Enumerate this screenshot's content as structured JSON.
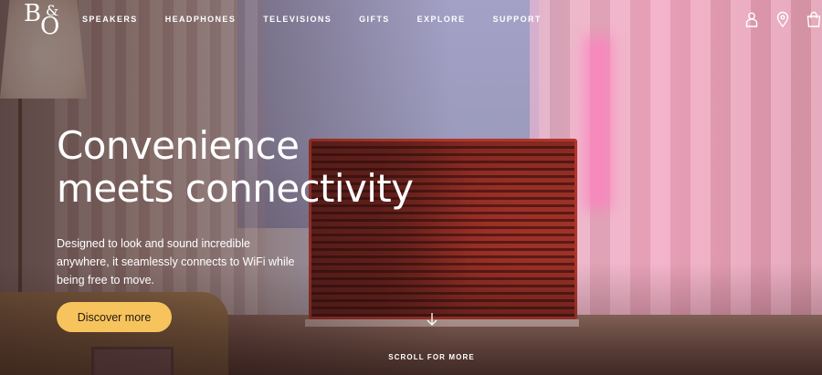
{
  "brand": {
    "logo_top": "B",
    "logo_amp": "&",
    "logo_bottom": "O"
  },
  "nav": {
    "items": [
      {
        "label": "SPEAKERS"
      },
      {
        "label": "HEADPHONES"
      },
      {
        "label": "TELEVISIONS"
      },
      {
        "label": "GIFTS"
      },
      {
        "label": "EXPLORE"
      },
      {
        "label": "SUPPORT"
      }
    ],
    "icons": [
      "account-icon",
      "store-location-icon",
      "shopping-bag-icon"
    ]
  },
  "hero": {
    "headline_line1": "Convenience",
    "headline_line2": "meets connectivity",
    "subtext_line1": "Designed to look and sound incredible",
    "subtext_line2": "anywhere, it seamlessly connects to WiFi while",
    "subtext_line3": "being free to move.",
    "cta_label": "Discover more",
    "scroll_label": "SCROLL FOR MORE"
  },
  "colors": {
    "cta_background": "#f6c35d",
    "text": "#ffffff"
  }
}
